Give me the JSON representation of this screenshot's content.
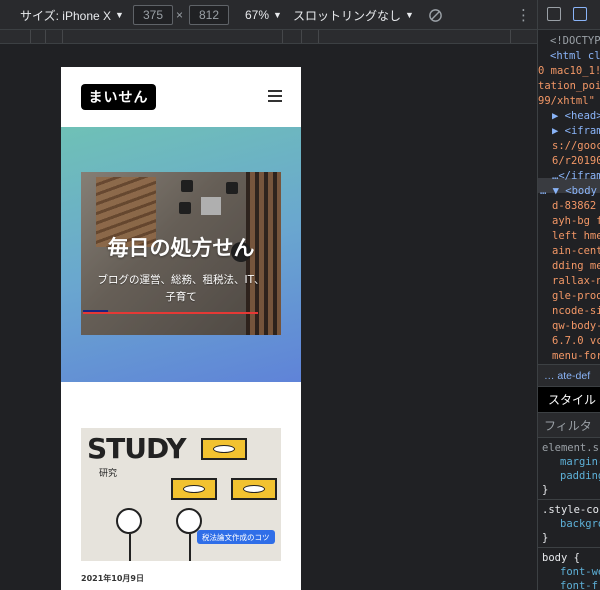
{
  "device_toolbar": {
    "device_label": "サイズ: iPhone X",
    "width_value": "375",
    "times": "×",
    "height_value": "812",
    "zoom": "67%",
    "throttle": "スロットリングなし",
    "more_icon": "⋮"
  },
  "site": {
    "logo": "まいせん",
    "hero_title": "毎日の処方せん",
    "hero_subtitle": "ブログの運営、総務、租税法、IT、子育て",
    "hero_progress_fraction": 0.14,
    "card_heading": "STUDY",
    "card_subheading": "研究",
    "card_tag": "税法論文作成のコツ",
    "post_date": "2021年10月9日"
  },
  "devtools": {
    "dom_lines": [
      {
        "text": "<!DOCTYP",
        "cls": "grayc",
        "indent": 12
      },
      {
        "text": "<html cl",
        "cls": "tagc",
        "indent": 12
      },
      {
        "text": "0 mac10_1!",
        "cls": "attrc",
        "indent": 0
      },
      {
        "text": "tation_poi",
        "cls": "attrc",
        "indent": 0
      },
      {
        "text": "99/xhtml\"",
        "cls": "attrc",
        "indent": 0
      },
      {
        "text": "▶ <head>",
        "cls": "tagc",
        "indent": 14
      },
      {
        "text": "▶ <ifram",
        "cls": "tagc",
        "indent": 14
      },
      {
        "text": "s://gooc",
        "cls": "attrc",
        "indent": 14
      },
      {
        "text": "6/r20190",
        "cls": "attrc",
        "indent": 14
      },
      {
        "text": "…</ifram",
        "cls": "tagc",
        "indent": 14
      },
      {
        "text": "… ▼ <body",
        "cls": "tagc",
        "indent": 2
      },
      {
        "text": "d-83862",
        "cls": "attrc",
        "indent": 14
      },
      {
        "text": "ayh-bg f",
        "cls": "attrc",
        "indent": 14
      },
      {
        "text": "left hme",
        "cls": "attrc",
        "indent": 14
      },
      {
        "text": "ain-cent",
        "cls": "attrc",
        "indent": 14
      },
      {
        "text": "dding me",
        "cls": "attrc",
        "indent": 14
      },
      {
        "text": "rallax-n",
        "cls": "attrc",
        "indent": 14
      },
      {
        "text": "gle-prod",
        "cls": "attrc",
        "indent": 14
      },
      {
        "text": "ncode-si",
        "cls": "attrc",
        "indent": 14
      },
      {
        "text": "qw-body-",
        "cls": "attrc",
        "indent": 14
      },
      {
        "text": "6.7.0 vc",
        "cls": "attrc",
        "indent": 14
      },
      {
        "text": "menu-for",
        "cls": "attrc",
        "indent": 14
      },
      {
        "text": "p: 0px;",
        "cls": "attrc",
        "indent": 14
      }
    ],
    "breadcrumb": "…  ate-def",
    "styles_tab": "スタイル",
    "filter_placeholder": "フィルタ",
    "css_lines": [
      {
        "text": "element.s",
        "cls": "grayc",
        "indent": 4
      },
      {
        "text": "margin-",
        "cls": "propc",
        "indent": 22
      },
      {
        "text": "padding",
        "cls": "propc",
        "indent": 22
      },
      {
        "text": "}",
        "cls": "whitec",
        "indent": 4
      },
      {
        "text": ".style-co",
        "cls": "whitec",
        "indent": 4
      },
      {
        "text": "backgro",
        "cls": "propc",
        "indent": 22
      },
      {
        "text": "}",
        "cls": "whitec",
        "indent": 4
      },
      {
        "text": "body {",
        "cls": "whitec",
        "indent": 4
      },
      {
        "text": "font-we",
        "cls": "propc",
        "indent": 22
      },
      {
        "text": "font-f",
        "cls": "propc",
        "indent": 22
      }
    ]
  }
}
